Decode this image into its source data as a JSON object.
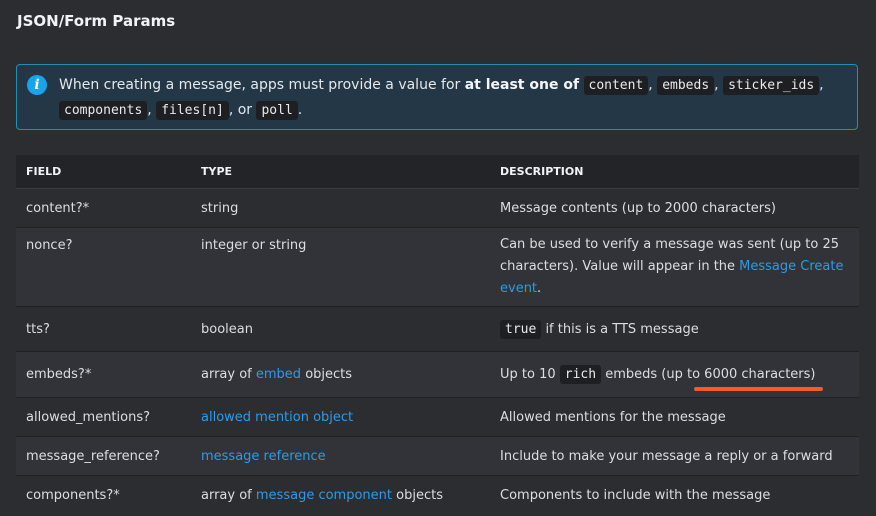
{
  "title": "JSON/Form Params",
  "callout": {
    "icon": "info-icon",
    "text_before": "When creating a message, apps must provide a value for ",
    "bold": "at least one of",
    "codes": [
      "content",
      "embeds",
      "sticker_ids",
      "components",
      "files[n]",
      "poll"
    ],
    "sep1": ", ",
    "sep2": ", ",
    "sep3": ", ",
    "sep4": ", ",
    "sep_or": ", or ",
    "end": "."
  },
  "table": {
    "headers": [
      "FIELD",
      "TYPE",
      "DESCRIPTION"
    ],
    "rows": [
      {
        "field": "content?*",
        "type": "string",
        "desc": "Message contents (up to 2000 characters)"
      },
      {
        "field": "nonce?",
        "type": "integer or string",
        "desc_before": "Can be used to verify a message was sent (up to 25 characters). Value will appear in the ",
        "desc_link": "Message Create event",
        "desc_after": "."
      },
      {
        "field": "tts?",
        "type": "boolean",
        "desc_code": "true",
        "desc": " if this is a TTS message"
      },
      {
        "field": "embeds?*",
        "type_before": "array of ",
        "type_link": "embed",
        "type_after": " objects",
        "desc_before": "Up to 10 ",
        "desc_code": "rich",
        "desc_mid": " embeds (up to ",
        "desc_highlight": "6000 characters)"
      },
      {
        "field": "allowed_mentions?",
        "type_link": "allowed mention object",
        "desc": "Allowed mentions for the message"
      },
      {
        "field": "message_reference?",
        "type_link": "message reference",
        "desc": "Include to make your message a reply or a forward"
      },
      {
        "field": "components?*",
        "type_before": "array of ",
        "type_link": "message component",
        "type_after": " objects",
        "desc": "Components to include with the message"
      }
    ]
  },
  "colors": {
    "link": "#2e9be6",
    "underline": "#ff5a1f",
    "callout_border": "#1f8fb8"
  }
}
